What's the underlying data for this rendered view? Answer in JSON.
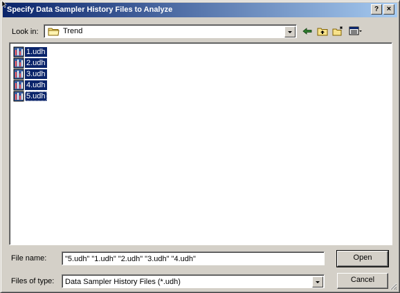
{
  "dialog": {
    "title": "Specify Data Sampler History Files to Analyze",
    "help_label": "?",
    "close_label": "×"
  },
  "lookin": {
    "label": "Look in:",
    "value": "Trend"
  },
  "toolbar": {
    "icons": [
      "back-icon",
      "up-folder-icon",
      "new-folder-icon",
      "view-menu-icon"
    ]
  },
  "files": [
    {
      "name": "1.udh"
    },
    {
      "name": "2.udh"
    },
    {
      "name": "3.udh"
    },
    {
      "name": "4.udh"
    },
    {
      "name": "5.udh"
    }
  ],
  "filename": {
    "label": "File name:",
    "value": "\"5.udh\" \"1.udh\" \"2.udh\" \"3.udh\" \"4.udh\""
  },
  "filetype": {
    "label": "Files of type:",
    "value": "Data Sampler History Files (*.udh)"
  },
  "buttons": {
    "open": "Open",
    "cancel": "Cancel"
  },
  "colors": {
    "titlebar_start": "#0a246a",
    "titlebar_end": "#a6caf0",
    "selection": "#0a246a",
    "face": "#d4d0c8"
  }
}
